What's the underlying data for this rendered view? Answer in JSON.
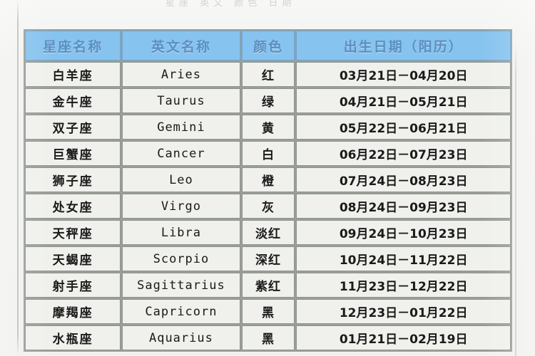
{
  "page": {
    "top_clipped_text": "星座 英文 颜色 日期",
    "background_color": "#f1f2ef"
  },
  "table": {
    "header_bg": "#87c3ef",
    "header_text_color": "#5a8fc0",
    "cell_bg": "#f0f1ed",
    "grid_color": "#8e938c",
    "columns": [
      {
        "key": "name",
        "label": "星座名称"
      },
      {
        "key": "en",
        "label": "英文名称"
      },
      {
        "key": "color",
        "label": "颜色"
      },
      {
        "key": "date",
        "label": "出生日期（阳历）"
      }
    ],
    "rows": [
      {
        "name": "白羊座",
        "en": "Aries",
        "color": "红",
        "date": "03月21日－04月20日"
      },
      {
        "name": "金牛座",
        "en": "Taurus",
        "color": "绿",
        "date": "04月21日－05月21日"
      },
      {
        "name": "双子座",
        "en": "Gemini",
        "color": "黄",
        "date": "05月22日－06月21日"
      },
      {
        "name": "巨蟹座",
        "en": "Cancer",
        "color": "白",
        "date": "06月22日－07月23日"
      },
      {
        "name": "狮子座",
        "en": "Leo",
        "color": "橙",
        "date": "07月24日－08月23日"
      },
      {
        "name": "处女座",
        "en": "Virgo",
        "color": "灰",
        "date": "08月24日－09月23日"
      },
      {
        "name": "天秤座",
        "en": "Libra",
        "color": "淡红",
        "date": "09月24日－10月23日"
      },
      {
        "name": "天蝎座",
        "en": "Scorpio",
        "color": "深红",
        "date": "10月24日－11月22日"
      },
      {
        "name": "射手座",
        "en": "Sagittarius",
        "color": "紫红",
        "date": "11月23日－12月22日"
      },
      {
        "name": "摩羯座",
        "en": "Capricorn",
        "color": "黑",
        "date": "12月23日－01月22日"
      },
      {
        "name": "水瓶座",
        "en": "Aquarius",
        "color": "黑",
        "date": "01月21日－02月19日"
      }
    ]
  }
}
